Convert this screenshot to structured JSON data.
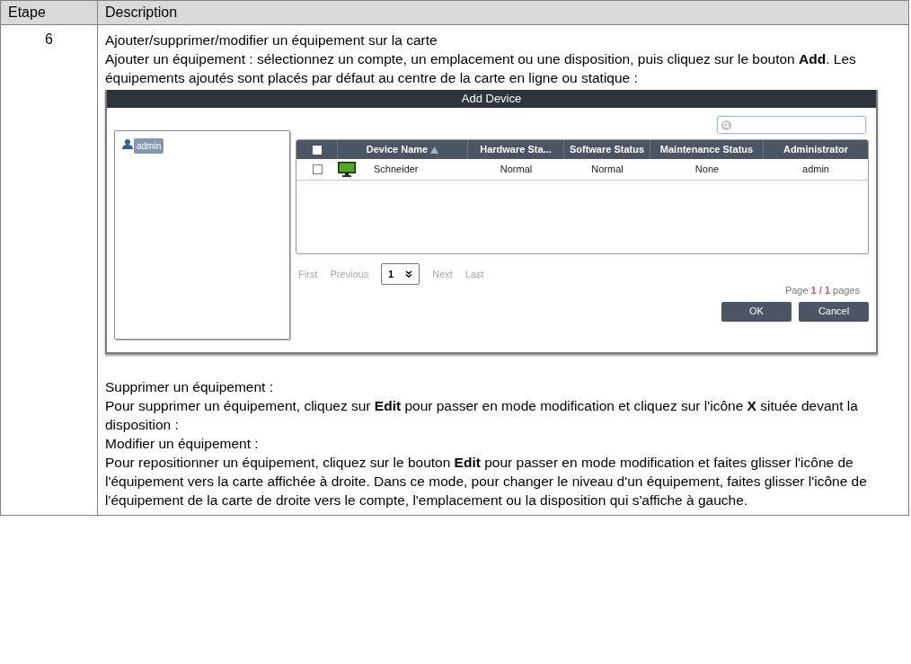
{
  "table": {
    "columns": [
      "Etape",
      "Description"
    ],
    "rows": [
      {
        "step": "6",
        "blocks": [
          {
            "kind": "heading",
            "text": "Ajouter/supprimer/modifier un équipement sur la carte"
          },
          {
            "kind": "paragraph",
            "text": "Ajouter un équipement : sélectionnez un compte, un emplacement ou une disposition, puis cliquez sur le bouton **Add**. Les équipements ajoutés sont placés par défaut au centre de la carte en ligne ou statique :"
          },
          {
            "kind": "dialog",
            "title": "Add Device",
            "tree_items": [
              {
                "label": "admin",
                "selected": true
              }
            ],
            "header_checkbox": {
              "checked": false
            },
            "grid_columns": [
              {
                "label": "Device Name",
                "sorted": true
              },
              {
                "label": "Hardware Sta...",
                "sorted": false
              },
              {
                "label": "Software Status",
                "sorted": false
              },
              {
                "label": "Maintenance Status",
                "sorted": false
              },
              {
                "label": "Administrator",
                "sorted": false
              }
            ],
            "grid_rows": [
              {
                "checked": false,
                "cells": [
                  "Schneider",
                  "Normal",
                  "Normal",
                  "None",
                  "admin"
                ]
              }
            ],
            "pager": {
              "first": "First",
              "previous": "Previous",
              "page": "1",
              "next": "Next",
              "last": "Last",
              "page_label": "Page",
              "page_current": "1 / 1",
              "page_suffix": "pages"
            },
            "buttons": [
              "OK",
              "Cancel"
            ]
          },
          {
            "kind": "heading",
            "text": "Supprimer un équipement :"
          },
          {
            "kind": "paragraph",
            "text": "Pour supprimer un équipement, cliquez sur **Edit** pour passer en mode modification et cliquez sur l'icône **X** située devant la disposition :"
          },
          {
            "kind": "heading",
            "text": "Modifier un équipement :"
          },
          {
            "kind": "paragraph",
            "text": "Pour repositionner un équipement, cliquez sur le bouton **Edit** pour passer en mode modification et faites glisser l'icône de l'équipement vers la carte affichée à droite. Dans ce mode, pour changer le niveau d'un équipement, faites glisser l'icône de l'équipement de la carte de droite vers le compte, l'emplacement ou la disposition qui s'affiche à gauche."
          }
        ]
      }
    ]
  }
}
